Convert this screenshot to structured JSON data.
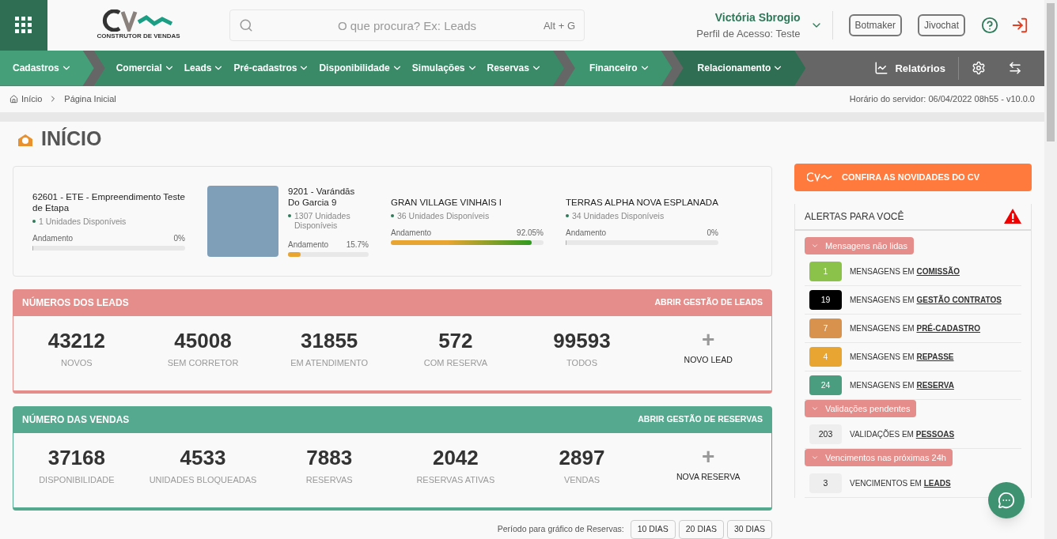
{
  "header": {
    "logo_tagline": "CONSTRUTOR DE VENDAS",
    "search": {
      "placeholder": "O que procura? Ex: Leads",
      "shortcut": "Alt + G"
    },
    "user": {
      "name": "Victória Sbrogio",
      "profile": "Perfil de Acesso: Teste"
    },
    "buttons": [
      "Botmaker",
      "Jivochat"
    ]
  },
  "nav": {
    "groups": [
      {
        "color": "#45a07a",
        "items": [
          "Cadastros"
        ]
      },
      {
        "color": "#3a8a68",
        "items": [
          "Comercial",
          "Leads",
          "Pré-cadastros",
          "Disponibilidade",
          "Simulações",
          "Reservas"
        ]
      },
      {
        "color": "#3f9470",
        "items": [
          "Financeiro"
        ]
      },
      {
        "color": "#2f6e52",
        "items": [
          "Relacionamento"
        ]
      }
    ],
    "reports": "Relatórios"
  },
  "breadcrumb": {
    "items": [
      "Início",
      "Página Inicial"
    ],
    "server_time": "Horário do servidor: 06/04/2022 08h55 - v10.0.0"
  },
  "page_title": "INÍCIO",
  "projects": [
    {
      "name": "62601 - ETE - Empreendimento Teste de Etapa",
      "units": "1 Unidades Disponíveis",
      "progress_label": "Andamento",
      "percent": "0%",
      "level": 0.005,
      "photo": false
    },
    {
      "name": "9201 - Varándās Do Garcia 9",
      "units": "1307 Unidades Disponíveis",
      "progress_label": "Andamento",
      "percent": "15.7%",
      "level": 0.157,
      "photo": true
    },
    {
      "name": "GRAN VILLAGE VINHAIS I",
      "units": "36 Unidades Disponíveis",
      "progress_label": "Andamento",
      "percent": "92.05%",
      "level": 0.9205,
      "photo": false
    },
    {
      "name": "TERRAS ALPHA NOVA ESPLANADA",
      "units": "34 Unidades Disponíveis",
      "progress_label": "Andamento",
      "percent": "0%",
      "level": 0.005,
      "photo": false
    }
  ],
  "panels": [
    {
      "title": "NÚMEROS DOS LEADS",
      "link": "ABRIR GESTÃO DE LEADS",
      "color": "#e58d8a",
      "stats": [
        {
          "value": "43212",
          "label": "NOVOS"
        },
        {
          "value": "45008",
          "label": "SEM CORRETOR"
        },
        {
          "value": "31855",
          "label": "EM ATENDIMENTO"
        },
        {
          "value": "572",
          "label": "COM RESERVA"
        },
        {
          "value": "99593",
          "label": "TODOS"
        }
      ],
      "add": {
        "symbol": "+",
        "label": "NOVO LEAD"
      }
    },
    {
      "title": "NÚMERO DAS VENDAS",
      "link": "ABRIR GESTÃO DE RESERVAS",
      "color": "#55a98f",
      "stats": [
        {
          "value": "37168",
          "label": "DISPONIBILIDADE"
        },
        {
          "value": "4533",
          "label": "UNIDADES BLOQUEADAS"
        },
        {
          "value": "7883",
          "label": "RESERVAS"
        },
        {
          "value": "2042",
          "label": "RESERVAS ATIVAS"
        },
        {
          "value": "2897",
          "label": "VENDAS"
        }
      ],
      "add": {
        "symbol": "+",
        "label": "NOVA RESERVA"
      }
    }
  ],
  "chart_period": {
    "label": "Período para gráfico de Reservas:",
    "buttons": [
      "10 DIAS",
      "20 DIAS",
      "30 DIAS"
    ]
  },
  "news_button": "CONFIRA AS NOVIDADES DO CV",
  "alerts": {
    "title": "ALERTAS PARA VOCÊ",
    "sections": [
      {
        "title": "Mensagens não lidas",
        "expanded": true,
        "items": [
          {
            "count": "1",
            "color": "#8bc34a",
            "prefix": "MENSAGENS EM",
            "link": "COMISSÃO"
          },
          {
            "count": "19",
            "color": "#000000",
            "prefix": "MENSAGENS EM",
            "link": "GESTÃO CONTRATOS"
          },
          {
            "count": "7",
            "color": "#d9924d",
            "prefix": "MENSAGENS EM",
            "link": "PRÉ-CADASTRO"
          },
          {
            "count": "4",
            "color": "#e9a532",
            "prefix": "MENSAGENS EM",
            "link": "REPASSE"
          },
          {
            "count": "24",
            "color": "#4a9e7f",
            "prefix": "MENSAGENS EM",
            "link": "RESERVA"
          }
        ]
      },
      {
        "title": "Validações pendentes",
        "expanded": true,
        "items": [
          {
            "count": "203",
            "color": "#eeeeee",
            "prefix": "VALIDAÇÕES EM",
            "link": "PESSOAS"
          }
        ]
      },
      {
        "title": "Vencimentos nas próximas 24h",
        "expanded": true,
        "items": [
          {
            "count": "3",
            "color": "#eeeeee",
            "prefix": "VENCIMENTOS EM",
            "link": "LEADS"
          }
        ]
      }
    ]
  }
}
